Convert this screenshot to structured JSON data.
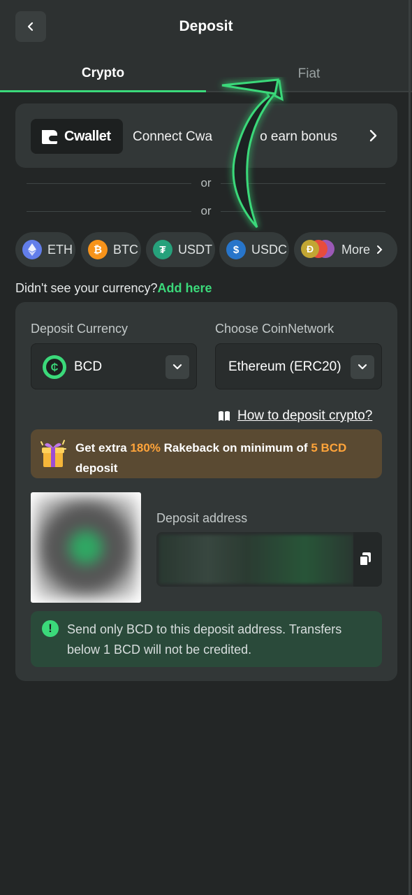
{
  "header": {
    "title": "Deposit",
    "back_icon": "chevron-left-icon"
  },
  "tabs": [
    {
      "label": "Crypto",
      "active": true
    },
    {
      "label": "Fiat",
      "active": false
    }
  ],
  "cwallet": {
    "logo_text": "Cwallet",
    "promo_text": "Connect Cwallet to earn bonus",
    "visible_promo_text": "Connect Cwa",
    "visible_promo_tail": "o earn bonus"
  },
  "divider": {
    "or1": "or",
    "or2": "or"
  },
  "coins": [
    {
      "label": "ETH",
      "icon": "eth-icon",
      "color": "#627eea"
    },
    {
      "label": "BTC",
      "icon": "btc-icon",
      "color": "#f7931a"
    },
    {
      "label": "USDT",
      "icon": "usdt-icon",
      "color": "#26a17b"
    },
    {
      "label": "USDC",
      "icon": "usdc-icon",
      "color": "#2775ca"
    },
    {
      "label": "More",
      "icon": "more-coins-icon"
    }
  ],
  "notice": {
    "question": "Didn't see your currency?",
    "link": "Add here"
  },
  "deposit": {
    "currency_label": "Deposit Currency",
    "currency_value": "BCD",
    "network_label": "Choose CoinNetwork",
    "network_value": "Ethereum (ERC20)",
    "howto_link": "How to deposit crypto?",
    "promo": {
      "prefix": "Get extra ",
      "percent": "180%",
      "middle": " Rakeback on minimum of ",
      "amount": "5 BCD",
      "suffix": "deposit"
    },
    "address_label": "Deposit address",
    "warning": "Send only BCD to this deposit address. Transfers below 1 BCD will not be credited."
  },
  "colors": {
    "accent": "#3bd97a",
    "promo_highlight": "#ffa43a",
    "background": "#232626"
  }
}
